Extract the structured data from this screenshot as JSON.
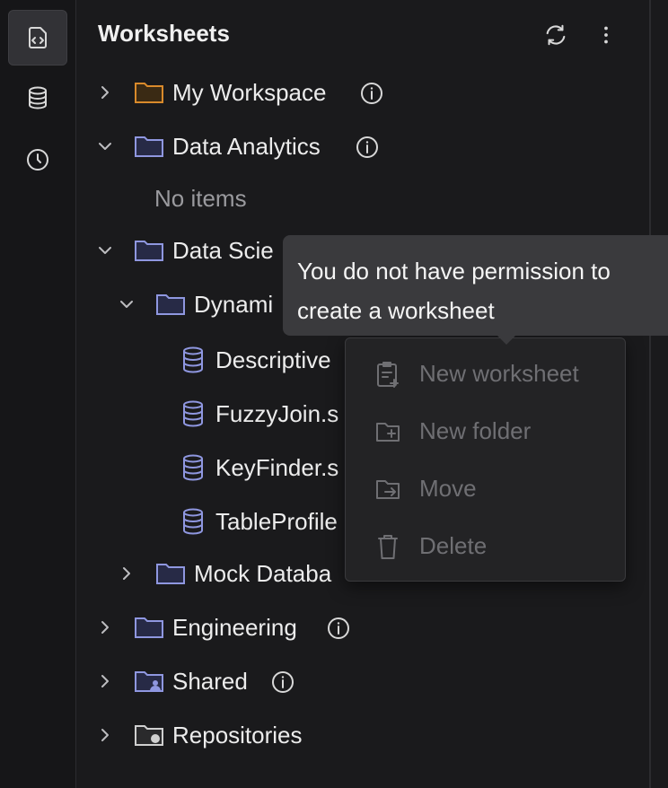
{
  "panel": {
    "title": "Worksheets"
  },
  "tree": {
    "my_workspace": "My Workspace",
    "data_analytics": "Data Analytics",
    "no_items": "No items",
    "data_science": "Data Scie",
    "dynamic": "Dynami",
    "file_descriptive": "Descriptive",
    "file_fuzzyjoin": "FuzzyJoin.s",
    "file_keyfinder": "KeyFinder.s",
    "file_tableprofile": "TableProfile",
    "mock_database": "Mock Databa",
    "engineering": "Engineering",
    "shared": "Shared",
    "repositories": "Repositories"
  },
  "tooltip": {
    "line1": "You do not have permission to",
    "line2": "create a worksheet"
  },
  "menu": {
    "new_worksheet": "New worksheet",
    "new_folder": "New folder",
    "move": "Move",
    "delete": "Delete"
  },
  "colors": {
    "folder_orange": "#d98a2b",
    "folder_blue": "#8f97e0",
    "background": "#1a1a1c",
    "tooltip_bg": "#3a3a3d"
  }
}
